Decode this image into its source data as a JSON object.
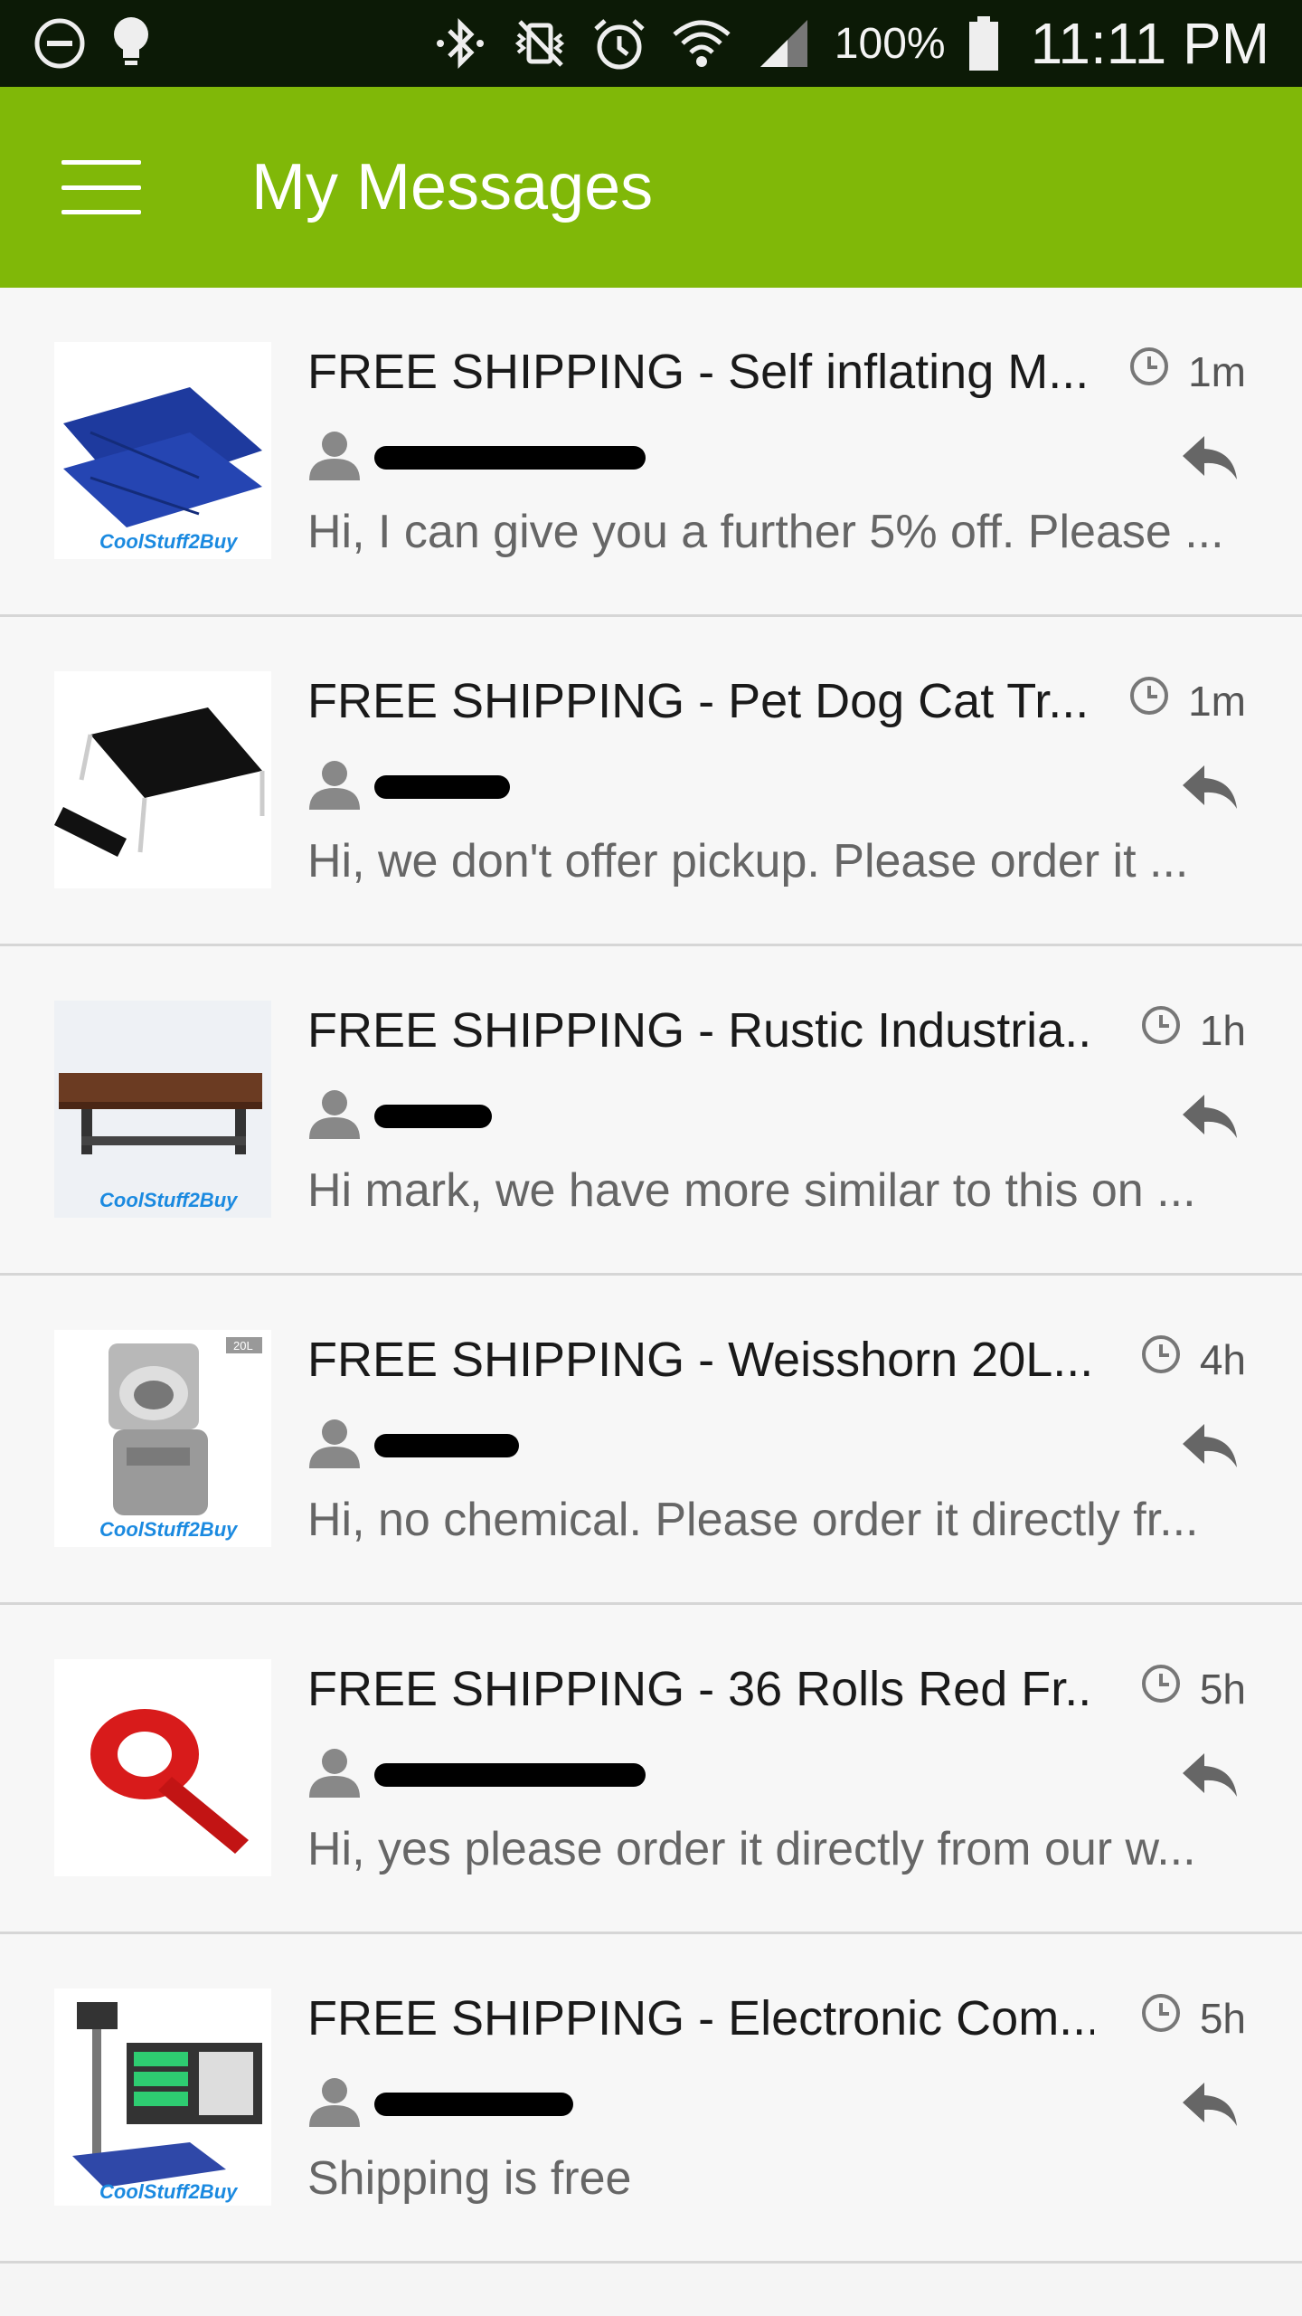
{
  "status_bar": {
    "battery": "100%",
    "time": "11:11 PM",
    "icons": [
      "do-not-disturb-icon",
      "lightbulb-icon",
      "bluetooth-icon",
      "vibrate-icon",
      "alarm-icon",
      "wifi-icon",
      "signal-icon",
      "battery-icon"
    ]
  },
  "appbar": {
    "title": "My Messages",
    "menu_icon": "hamburger-menu-icon"
  },
  "messages": [
    {
      "title": "FREE SHIPPING - Self inflating M...",
      "time": "1m",
      "preview": "Hi, I can give you a further 5% off. Please ...",
      "thumb": "blue-mattress"
    },
    {
      "title": "FREE SHIPPING - Pet Dog Cat Tr...",
      "time": "1m",
      "preview": "Hi, we don't offer pickup. Please order it ...",
      "thumb": "pet-bed"
    },
    {
      "title": "FREE SHIPPING - Rustic Industria...",
      "time": "1h",
      "preview": "Hi mark, we have more similar to this on ...",
      "thumb": "shelf"
    },
    {
      "title": "FREE SHIPPING - Weisshorn 20L...",
      "time": "4h",
      "preview": "Hi, no chemical. Please order it directly fr...",
      "thumb": "toilet"
    },
    {
      "title": "FREE SHIPPING - 36 Rolls Red Fr...",
      "time": "5h",
      "preview": "Hi, yes please order it directly from our w...",
      "thumb": "tape"
    },
    {
      "title": "FREE SHIPPING - Electronic Com...",
      "time": "5h",
      "preview": "Shipping is free",
      "thumb": "scale"
    }
  ],
  "thumb_labels": {
    "logo_text": "CoolStuff2Buy",
    "toilet_badge": "20L"
  },
  "colors": {
    "appbar": "#80b808",
    "statusbar": "#0c1a06"
  }
}
